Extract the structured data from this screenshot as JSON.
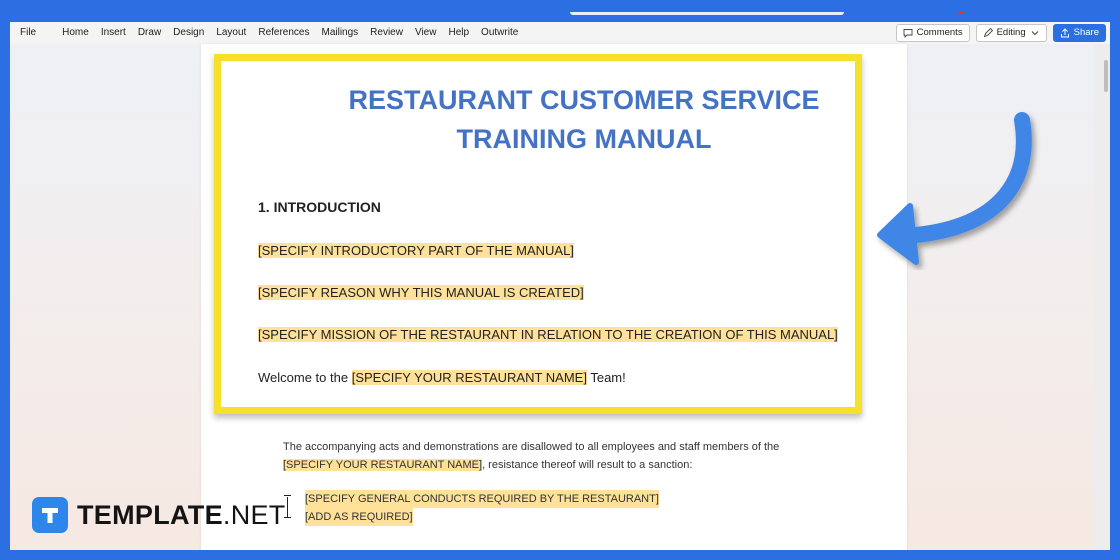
{
  "ribbon": {
    "tabs": [
      "File",
      "Home",
      "Insert",
      "Draw",
      "Design",
      "Layout",
      "References",
      "Mailings",
      "Review",
      "View",
      "Help",
      "Outwrite"
    ],
    "comments_label": "Comments",
    "editing_label": "Editing",
    "share_label": "Share"
  },
  "document": {
    "title_line1": "RESTAURANT CUSTOMER SERVICE",
    "title_line2": "TRAINING MANUAL",
    "section_heading": "1. INTRODUCTION",
    "placeholder_intro": "[SPECIFY INTRODUCTORY PART OF THE MANUAL]",
    "placeholder_reason": "[SPECIFY REASON WHY THIS MANUAL IS CREATED]",
    "placeholder_mission": "[SPECIFY MISSION OF THE RESTAURANT IN RELATION TO THE CREATION OF THIS MANUAL]",
    "welcome_prefix": "Welcome to the ",
    "welcome_placeholder": "[SPECIFY YOUR RESTAURANT NAME]",
    "welcome_suffix": " Team!",
    "body_line1": "The accompanying acts and demonstrations are disallowed to all employees and staff members of the",
    "body_placeholder": "[SPECIFY YOUR RESTAURANT NAME]",
    "body_line2_suffix": ", resistance thereof will result to a sanction:",
    "bullets": [
      "[SPECIFY GENERAL CONDUCTS REQUIRED BY THE RESTAURANT]",
      "[ADD AS REQUIRED]"
    ]
  },
  "brand": {
    "name": "TEMPLATE",
    "suffix": ".NET"
  },
  "colors": {
    "frame": "#2b6fe3",
    "title": "#4472c4",
    "highlight": "#ffe199",
    "callout_border": "#f5e02a",
    "arrow": "#3f86e6"
  }
}
